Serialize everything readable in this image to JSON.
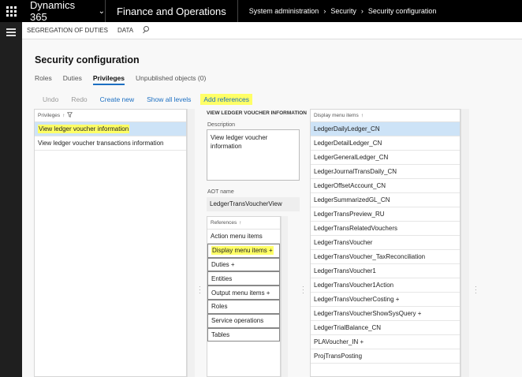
{
  "topbar": {
    "brand": "Dynamics 365",
    "module": "Finance and Operations",
    "breadcrumb": [
      "System administration",
      "Security",
      "Security configuration"
    ]
  },
  "actionbar": {
    "items": [
      "SEGREGATION OF DUTIES",
      "DATA"
    ]
  },
  "page": {
    "title": "Security configuration",
    "tabs": [
      "Roles",
      "Duties",
      "Privileges",
      "Unpublished objects (0)"
    ],
    "active_tab": "Privileges"
  },
  "toolbar": {
    "undo": "Undo",
    "redo": "Redo",
    "create_new": "Create new",
    "show_all_levels": "Show all levels",
    "add_references": "Add references"
  },
  "privileges": {
    "header": "Privileges",
    "sort_indicator": "↑",
    "rows": [
      "View ledger voucher information",
      "View ledger voucher transactions information"
    ]
  },
  "detail": {
    "title": "VIEW LEDGER VOUCHER INFORMATION",
    "description_label": "Description",
    "description": "View ledger voucher information",
    "aot_label": "AOT name",
    "aot_name": "LedgerTransVoucherView"
  },
  "references": {
    "header": "References",
    "sort_indicator": "↑",
    "rows": [
      "Action menu items",
      "Display menu items +",
      "Duties +",
      "Entities",
      "Output menu items +",
      "Roles",
      "Service operations",
      "Tables"
    ]
  },
  "display_menu_items": {
    "header": "Display menu items",
    "sort_indicator": "↑",
    "rows": [
      "LedgerDailyLedger_CN",
      "LedgerDetailLedger_CN",
      "LedgerGeneralLedger_CN",
      "LedgerJournalTransDaily_CN",
      "LedgerOffsetAccount_CN",
      "LedgerSummarizedGL_CN",
      "LedgerTransPreview_RU",
      "LedgerTransRelatedVouchers",
      "LedgerTransVoucher",
      "LedgerTransVoucher_TaxReconciliation",
      "LedgerTransVoucher1",
      "LedgerTransVoucher1Action",
      "LedgerTransVoucherCosting +",
      "LedgerTransVoucherShowSysQuery +",
      "LedgerTrialBalance_CN",
      "PLAVoucher_IN +",
      "ProjTransPosting"
    ]
  },
  "colors": {
    "accent": "#1c6fc2",
    "highlight": "#ffff66",
    "selected_row": "#cde3f7"
  }
}
